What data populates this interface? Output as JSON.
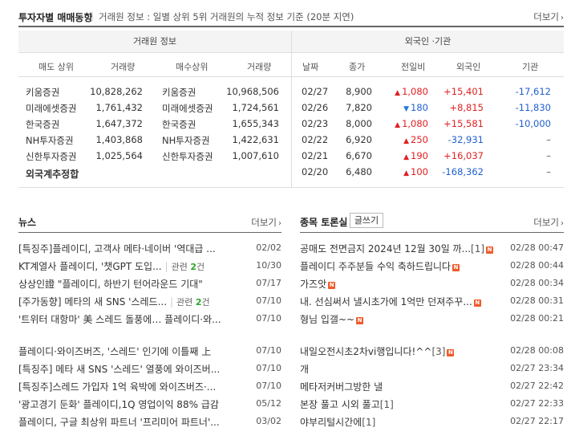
{
  "header": {
    "title": "투자자별 매매동향",
    "desc": "거래원 정보 : 일별 상위 5위 거래원의 누적 정보 기준 (20분 지연)",
    "more": "더보기"
  },
  "broker": {
    "group_label": "거래원 정보",
    "col_sell": "매도 상위",
    "col_sell_vol": "거래량",
    "col_buy": "매수상위",
    "col_buy_vol": "거래량",
    "rows": [
      {
        "sell": "키움증권",
        "sell_vol": "10,828,262",
        "buy": "키움증권",
        "buy_vol": "10,968,506"
      },
      {
        "sell": "미래에셋증권",
        "sell_vol": "1,761,432",
        "buy": "미래에셋증권",
        "buy_vol": "1,724,561"
      },
      {
        "sell": "한국증권",
        "sell_vol": "1,647,372",
        "buy": "한국증권",
        "buy_vol": "1,655,343"
      },
      {
        "sell": "NH투자증권",
        "sell_vol": "1,403,868",
        "buy": "NH투자증권",
        "buy_vol": "1,422,631"
      },
      {
        "sell": "신한투자증권",
        "sell_vol": "1,025,564",
        "buy": "신한투자증권",
        "buy_vol": "1,007,610"
      }
    ],
    "foreign_total": "외국계추정합"
  },
  "investor": {
    "group_label": "외국인 ·기관",
    "col_date": "날짜",
    "col_close": "종가",
    "col_change": "전일비",
    "col_foreign": "외국인",
    "col_inst": "기관",
    "rows": [
      {
        "date": "02/27",
        "close": "8,900",
        "dir": "up",
        "change": "1,080",
        "foreign": "+15,401",
        "inst": "-17,612"
      },
      {
        "date": "02/26",
        "close": "7,820",
        "dir": "down",
        "change": "180",
        "foreign": "+8,815",
        "inst": "-11,830"
      },
      {
        "date": "02/23",
        "close": "8,000",
        "dir": "up",
        "change": "1,080",
        "foreign": "+15,581",
        "inst": "-10,000"
      },
      {
        "date": "02/22",
        "close": "6,920",
        "dir": "up",
        "change": "250",
        "foreign": "-32,931",
        "inst": "–"
      },
      {
        "date": "02/21",
        "close": "6,670",
        "dir": "up",
        "change": "190",
        "foreign": "+16,037",
        "inst": "–"
      },
      {
        "date": "02/20",
        "close": "6,480",
        "dir": "up",
        "change": "100",
        "foreign": "-168,362",
        "inst": "–"
      }
    ]
  },
  "news": {
    "title": "뉴스",
    "more": "더보기",
    "items_top": [
      {
        "text": "[특징주]플레이디, 고객사 메타·네이버 '역대급 ...",
        "date": "02/02"
      },
      {
        "text": "KT계열사 플레이디, '챗GPT 도입...",
        "rel_label": "관련",
        "rel_count": "2",
        "rel_unit": "건",
        "date": "10/30"
      },
      {
        "text": "상상인證 \"플레이디, 하반기 턴어라운드 기대\"",
        "date": "07/17"
      },
      {
        "text": "[주가동향] 메타의 새 SNS '스레드...",
        "rel_label": "관련",
        "rel_count": "2",
        "rel_unit": "건",
        "date": "07/10"
      },
      {
        "text": "'트위터 대항마' 美 스레드 돌풍에… 플레이디·와...",
        "date": "07/10"
      }
    ],
    "items_bottom": [
      {
        "text": "플레이디·와이즈버즈, '스레드' 인기에 이틀째 上",
        "date": "07/10"
      },
      {
        "text": "[특징주] 메타 새 SNS '스레드' 열풍에 와이즈버...",
        "date": "07/10"
      },
      {
        "text": "[특징주]스레드 가입자 1억 육박에 와이즈버즈·...",
        "date": "07/10"
      },
      {
        "text": "'광고경기 둔화' 플레이디,1Q 영업이익 88% 급감",
        "date": "05/12"
      },
      {
        "text": "플레이디, 구글 최상위 파트너 '프리미어 파트너'...",
        "date": "03/02"
      }
    ]
  },
  "board": {
    "title": "종목 토론실",
    "write": "글쓰기",
    "more": "더보기",
    "new_badge": "N",
    "items_top": [
      {
        "text": "공매도 전면금지 2024년 12월 30일 까...",
        "count": "[1]",
        "new": true,
        "date": "02/28 00:47"
      },
      {
        "text": "플레이디 주주분들 수익 축하드립니다",
        "count": "",
        "new": true,
        "date": "02/28 00:44"
      },
      {
        "text": "가즈앗",
        "count": "",
        "new": true,
        "date": "02/28 00:34"
      },
      {
        "text": "내. 선심써서 낼시초가에 1억만 던져주꾸...",
        "count": "",
        "new": true,
        "date": "02/28 00:31"
      },
      {
        "text": "형님 입갤~~",
        "count": "",
        "new": true,
        "date": "02/28 00:21"
      }
    ],
    "items_bottom": [
      {
        "text": "내일오전시초2차vi행입니다!^^",
        "count": "[3]",
        "new": true,
        "date": "02/28 00:08"
      },
      {
        "text": "개",
        "count": "",
        "new": false,
        "date": "02/27 23:34"
      },
      {
        "text": "메타저커버그방한 낼",
        "count": "",
        "new": false,
        "date": "02/27 22:42"
      },
      {
        "text": "본장 풀고 시외 풀고",
        "count": "[1]",
        "new": false,
        "date": "02/27 22:33"
      },
      {
        "text": "야부리털시간에",
        "count": "[1]",
        "new": false,
        "date": "02/27 22:17"
      }
    ]
  }
}
